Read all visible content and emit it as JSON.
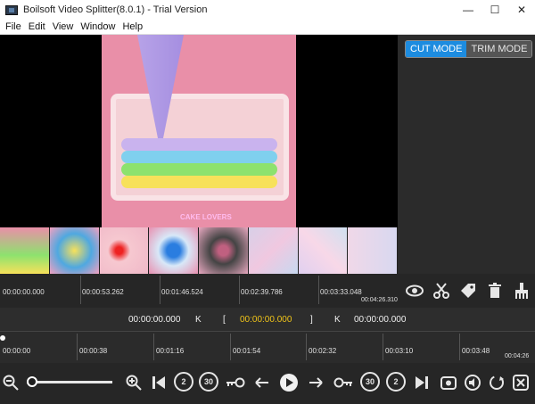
{
  "window": {
    "title": "Boilsoft Video Splitter(8.0.1) - Trial Version",
    "minimize": "—",
    "maximize": "☐",
    "close": "✕"
  },
  "menu": [
    "File",
    "Edit",
    "View",
    "Window",
    "Help"
  ],
  "video": {
    "watermark": "CAKE LOVERS"
  },
  "modes": {
    "cut": "CUT MODE",
    "trim": "TRIM MODE"
  },
  "timeline_top": {
    "labels": [
      "00:00:00.000",
      "00:00:53.262",
      "00:01:46.524",
      "00:02:39.786",
      "00:03:33.048",
      "00:04:26.310"
    ]
  },
  "timebar": {
    "start": "00:00:00.000",
    "prev_mark": "K",
    "bracket_open": "[",
    "current": "00:00:00.000",
    "bracket_close": "]",
    "next_mark": "K",
    "end": "00:00:00.000"
  },
  "timeline_bottom": {
    "labels": [
      "00:00:00",
      "00:00:38",
      "00:01:16",
      "00:01:54",
      "00:02:32",
      "00:03:10",
      "00:03:48",
      "00:04:26"
    ]
  },
  "colors": {
    "accent": "#1d8ce0",
    "current_time": "#f0c419"
  },
  "icons": {
    "preview": "eye-icon",
    "cut": "scissors-icon",
    "tag": "tag-icon",
    "delete": "trash-icon",
    "clear": "broom-icon"
  },
  "controls": {
    "skip_back_2": "2",
    "skip_back_30": "30",
    "skip_fwd_30": "30",
    "skip_fwd_2": "2"
  }
}
